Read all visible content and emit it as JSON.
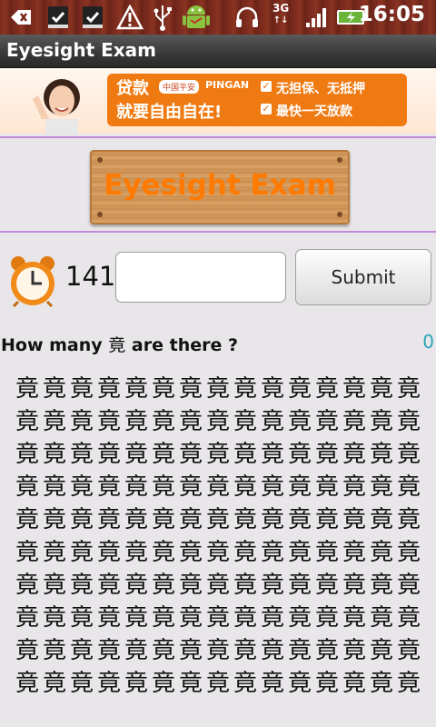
{
  "status_bar": {
    "time": "16:05",
    "network": "3G",
    "icons": [
      "back-icon",
      "download-done-icon",
      "download-done-icon",
      "warning-icon",
      "usb-icon",
      "android-icon",
      "headset-icon",
      "signal-icon",
      "battery-icon"
    ]
  },
  "app": {
    "title": "Eyesight Exam"
  },
  "ad": {
    "line1": "贷款",
    "line2": "就要自由自在!",
    "logo": "中国平安",
    "logo_en": "PINGAN",
    "check1": "无担保、无抵押",
    "check2": "最快一天放款"
  },
  "board": {
    "title": "Eyesight Exam"
  },
  "game": {
    "timer": "141",
    "answer_value": "",
    "submit_label": "Submit",
    "question_prefix": "How many",
    "question_char": "竟",
    "question_suffix": "are there ?",
    "score": "0"
  },
  "grid": {
    "rows": [
      [
        "竟",
        "竟",
        "竟",
        "竟",
        "竟",
        "竟",
        "竟",
        "竟",
        "竟",
        "竟",
        "竟",
        "竟",
        "竟",
        "竟",
        "竟"
      ],
      [
        "竟",
        "竟",
        "竟",
        "竟",
        "竟",
        "竟",
        "竟",
        "竟",
        "竟",
        "竟",
        "竟",
        "竟",
        "竟",
        "竟",
        "竟"
      ],
      [
        "竟",
        "竟",
        "竟",
        "竟",
        "竟",
        "竟",
        "竟",
        "竟",
        "竟",
        "竟",
        "竟",
        "竟",
        "竟",
        "竟",
        "竟"
      ],
      [
        "竟",
        "竟",
        "竟",
        "竟",
        "竟",
        "竟",
        "竟",
        "竟",
        "竟",
        "竟",
        "竟",
        "竟",
        "竟",
        "竟",
        "竟"
      ],
      [
        "竟",
        "竟",
        "竟",
        "竟",
        "竟",
        "竟",
        "竟",
        "竟",
        "竟",
        "竟",
        "竟",
        "竟",
        "竟",
        "竟",
        "竟"
      ],
      [
        "竟",
        "竟",
        "竟",
        "竟",
        "竟",
        "竟",
        "竟",
        "竟",
        "竟",
        "竟",
        "竟",
        "竟",
        "竟",
        "竟",
        "竟"
      ],
      [
        "竟",
        "竟",
        "竟",
        "竟",
        "竟",
        "竟",
        "竟",
        "竟",
        "竟",
        "竟",
        "竟",
        "竟",
        "竟",
        "竟",
        "竟"
      ],
      [
        "竟",
        "竟",
        "竟",
        "竟",
        "竟",
        "竟",
        "竟",
        "竟",
        "竟",
        "竟",
        "竟",
        "竟",
        "竟",
        "竟",
        "竟"
      ],
      [
        "竟",
        "竟",
        "竟",
        "竟",
        "竟",
        "竟",
        "竟",
        "竟",
        "竟",
        "竟",
        "竟",
        "竟",
        "竟",
        "竟",
        "竟"
      ],
      [
        "竟",
        "竟",
        "竟",
        "竟",
        "竟",
        "竟",
        "竟",
        "竟",
        "竟",
        "竟",
        "竟",
        "竟",
        "竟",
        "竟",
        "竟"
      ]
    ]
  },
  "colors": {
    "accent": "#ff7a00",
    "score": "#29a5b8",
    "divider": "#c28bd6"
  }
}
